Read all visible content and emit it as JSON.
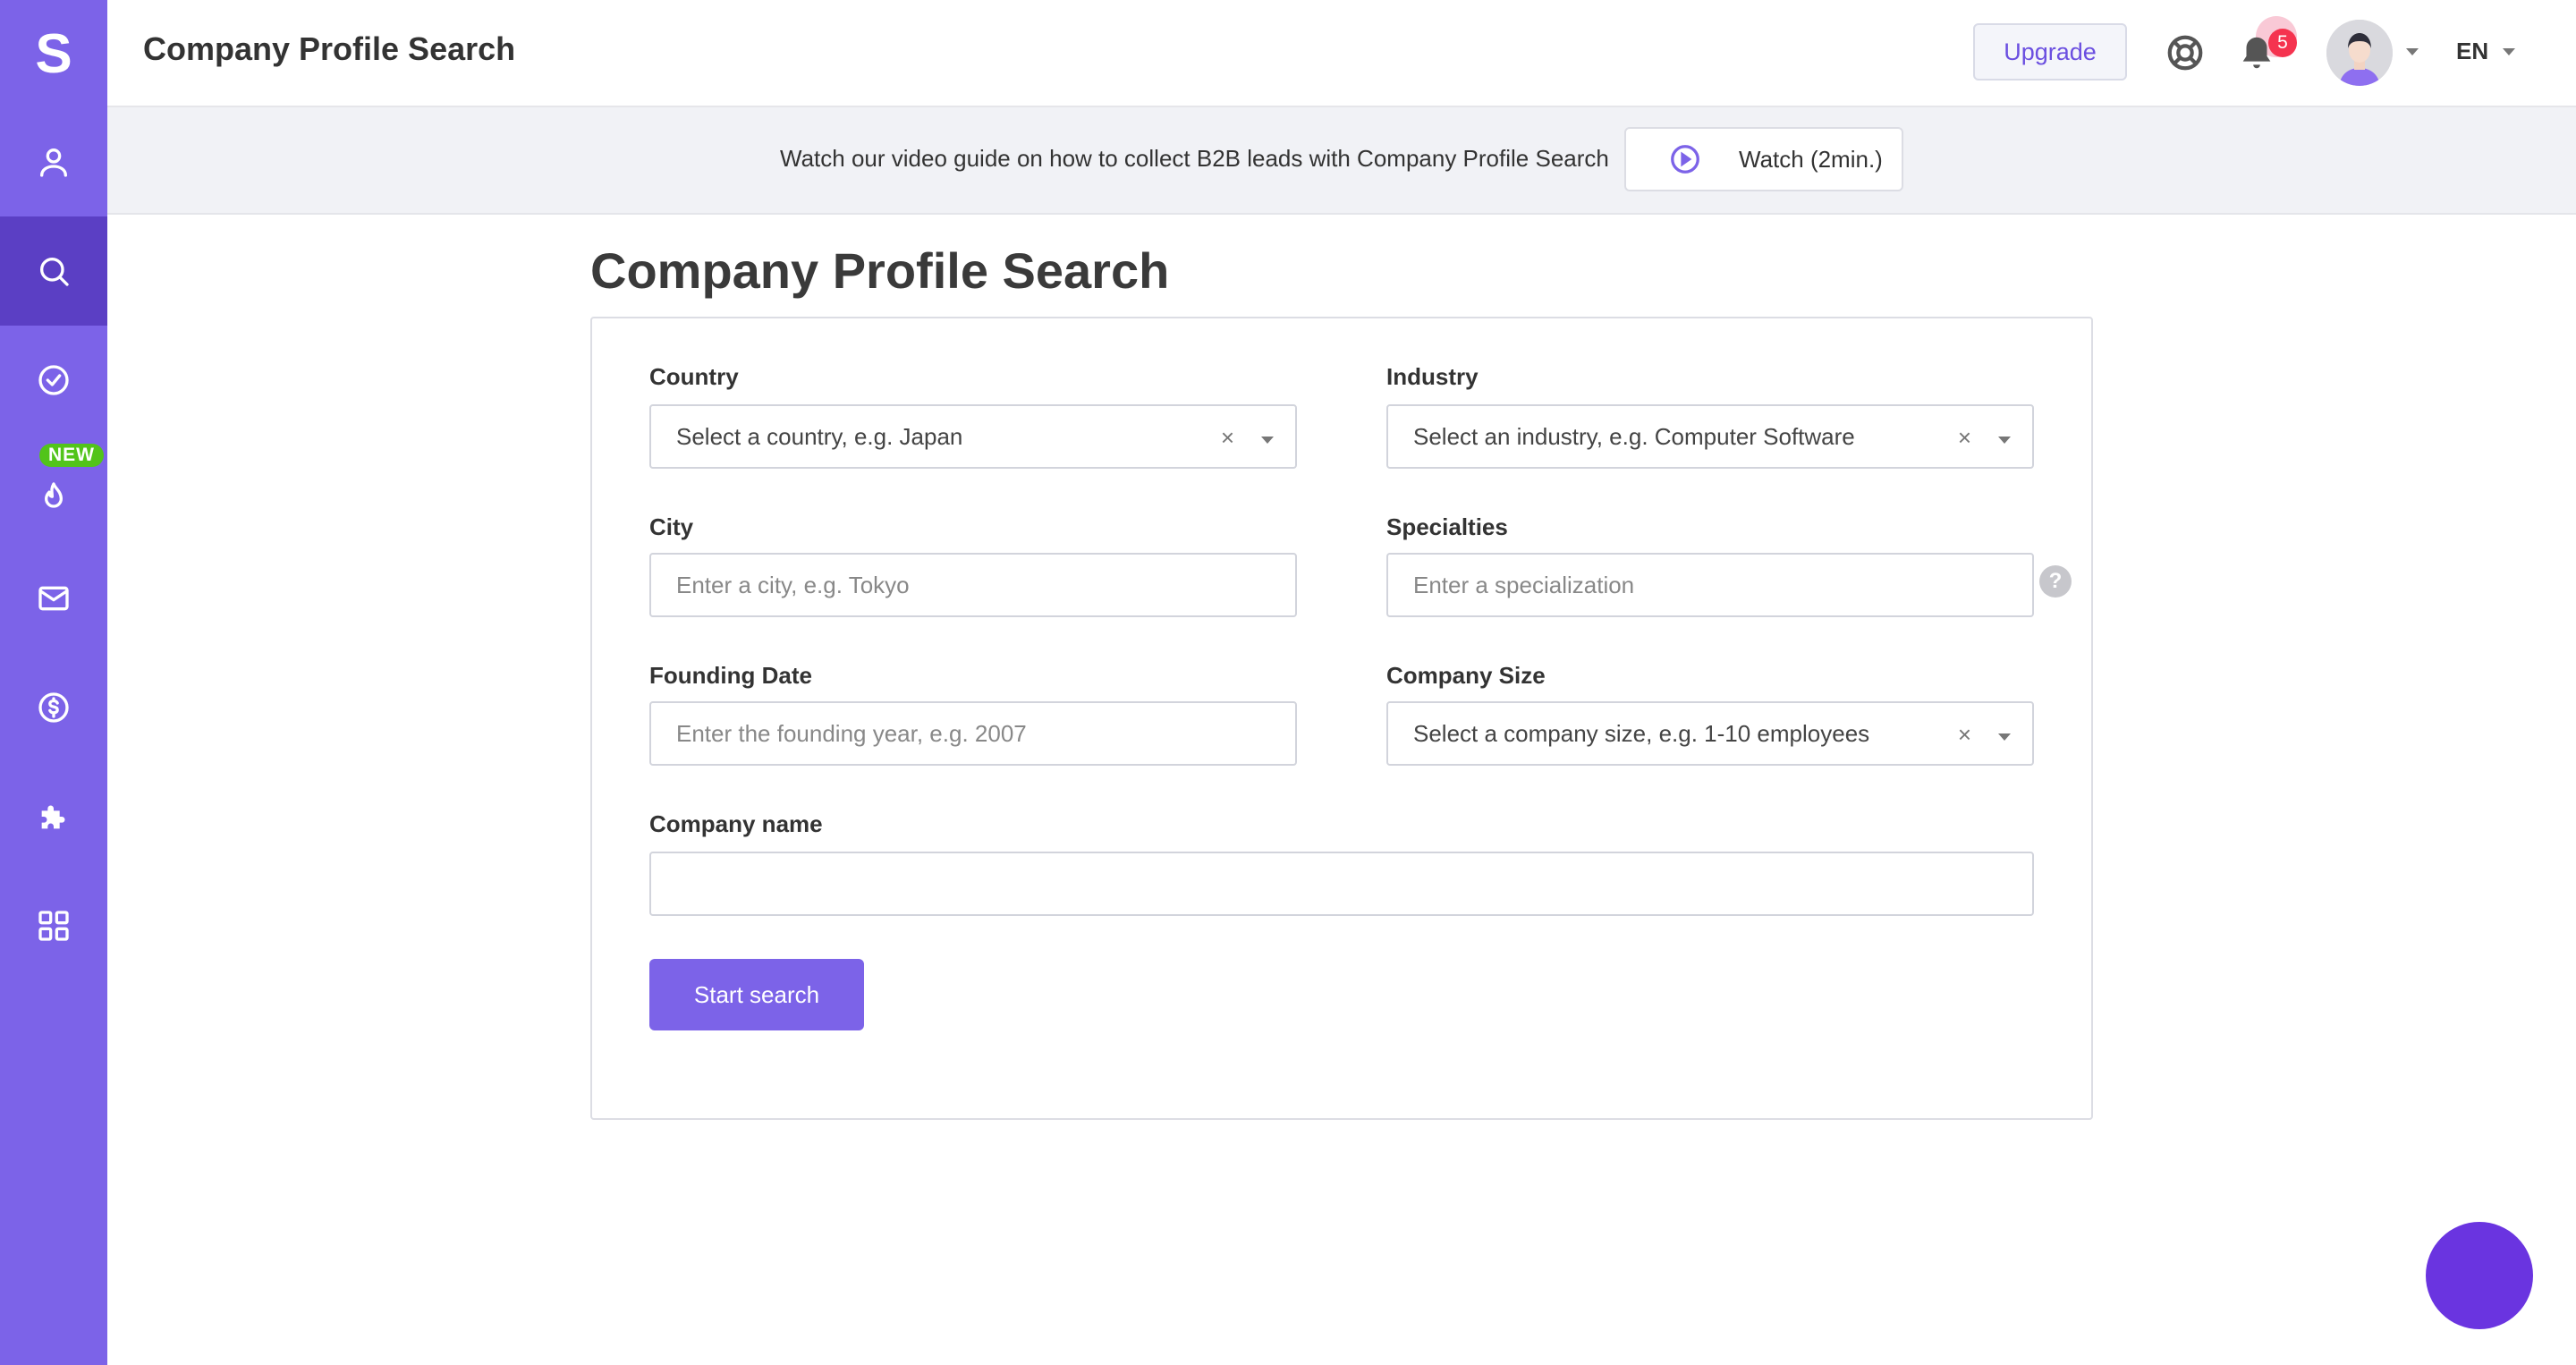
{
  "app": {
    "logo_letter": "S",
    "page_title": "Company Profile Search",
    "colors": {
      "sidebar": "#7c63e8",
      "sidebar_active": "#5b3fc4",
      "accent": "#7c63e8",
      "badge_new": "#52c41a",
      "notification": "#f5334f"
    }
  },
  "sidebar": {
    "new_badge": "NEW",
    "items": [
      {
        "name": "contacts",
        "icon": "user-icon"
      },
      {
        "name": "search",
        "icon": "search-icon",
        "active": true
      },
      {
        "name": "tasks",
        "icon": "check-circle-icon"
      },
      {
        "name": "hot",
        "icon": "flame-icon"
      },
      {
        "name": "email",
        "icon": "mail-icon"
      },
      {
        "name": "billing",
        "icon": "dollar-circle-icon"
      },
      {
        "name": "integrations",
        "icon": "puzzle-icon"
      },
      {
        "name": "apps",
        "icon": "grid-icon"
      }
    ]
  },
  "header": {
    "upgrade_label": "Upgrade",
    "notifications_count": "5",
    "language": "EN"
  },
  "banner": {
    "text": "Watch our video guide on how to collect B2B leads with Company Profile Search",
    "watch_label": "Watch (2min.)"
  },
  "form": {
    "title": "Company Profile Search",
    "country": {
      "label": "Country",
      "placeholder": "Select a country, e.g. Japan"
    },
    "industry": {
      "label": "Industry",
      "placeholder": "Select an industry, e.g. Computer Software"
    },
    "city": {
      "label": "City",
      "placeholder": "Enter a city, e.g. Tokyo"
    },
    "specialties": {
      "label": "Specialties",
      "placeholder": "Enter a specialization"
    },
    "founding_date": {
      "label": "Founding Date",
      "placeholder": "Enter the founding year, e.g. 2007"
    },
    "company_size": {
      "label": "Company Size",
      "placeholder": "Select a company size, e.g. 1-10 employees"
    },
    "company_name": {
      "label": "Company name",
      "placeholder": ""
    },
    "help_glyph": "?",
    "clear_glyph": "×",
    "submit_label": "Start search"
  }
}
